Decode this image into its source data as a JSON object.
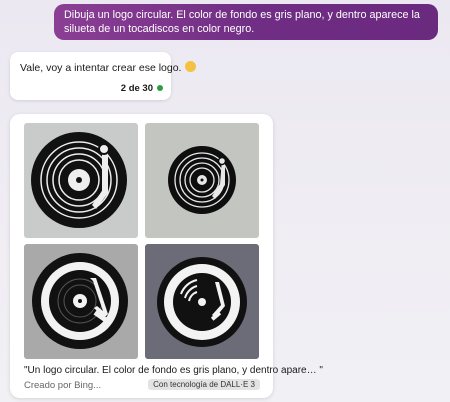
{
  "colors": {
    "user_bubble": "#7a3489",
    "status_dot": "#2e9b45"
  },
  "user_message": {
    "text": "Dibuja un logo circular. El color de fondo es gris plano, y dentro aparece la silueta de un tocadiscos en color negro."
  },
  "bot_message": {
    "text": "Vale, voy a intentar crear ese logo.",
    "emoji": "smiling-face-icon",
    "counter": "2 de 30"
  },
  "gallery": {
    "caption": "\"Un logo circular. El color de fondo es gris plano, y dentro apare… \"",
    "creator": "Creado por Bing...",
    "badge": "Con tecnología de DALL·E 3",
    "images": [
      {
        "name": "turntable-logo-1",
        "background": "#c9cbcb"
      },
      {
        "name": "turntable-logo-2",
        "background": "#c3c6c0"
      },
      {
        "name": "turntable-logo-3",
        "background": "#a9a9aa"
      },
      {
        "name": "turntable-logo-4",
        "background": "#6c6c78"
      }
    ]
  }
}
